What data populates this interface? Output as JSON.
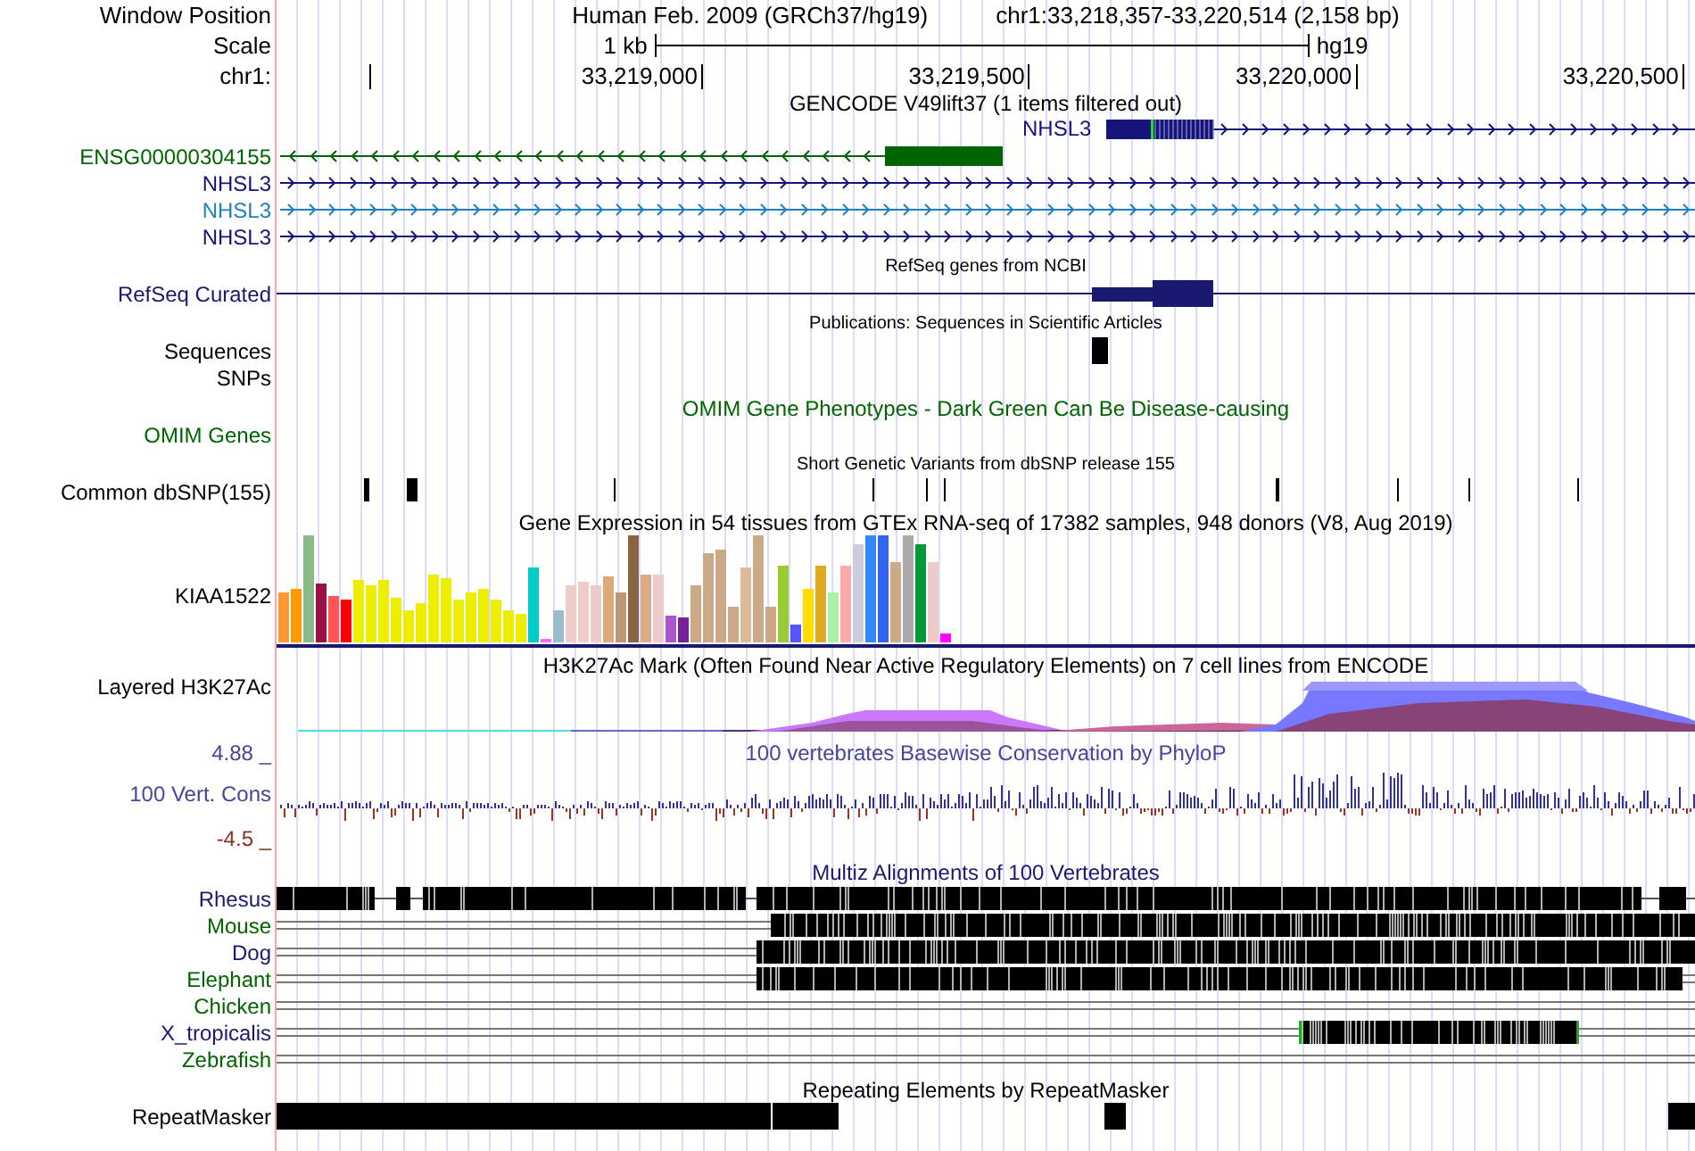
{
  "header": {
    "label": "Window Position",
    "assembly": "Human Feb. 2009 (GRCh37/hg19)",
    "position": "chr1:33,218,357-33,220,514 (2,158 bp)"
  },
  "scale": {
    "label": "Scale",
    "length": "1 kb",
    "assembly": "hg19"
  },
  "ruler": {
    "label": "chr1:",
    "ticks": [
      "33,219,000",
      "33,219,500",
      "33,220,000",
      "33,220,500"
    ]
  },
  "tracks": [
    {
      "kind": "gencode",
      "title": "GENCODE V49lift37 (1 items filtered out)",
      "genes": [
        {
          "name": "NHSL3",
          "name_inside": true,
          "reverse": false,
          "color": "#14147a"
        },
        {
          "name": "ENSG00000304155",
          "name_inside": false,
          "reverse": true,
          "color": "#006400"
        },
        {
          "name": "NHSL3",
          "name_inside": false,
          "reverse": false,
          "color": "#14147a"
        },
        {
          "name": "NHSL3",
          "name_inside": false,
          "reverse": false,
          "color": "#1f7fc0"
        },
        {
          "name": "NHSL3",
          "name_inside": false,
          "reverse": false,
          "color": "#14147a"
        }
      ]
    },
    {
      "kind": "refseq",
      "title": "RefSeq genes from NCBI",
      "label": "RefSeq Curated",
      "color": "#191970"
    },
    {
      "kind": "publications",
      "title": "Publications: Sequences in Scientific Articles",
      "label": "Sequences"
    },
    {
      "kind": "empty",
      "label": "SNPs"
    },
    {
      "kind": "omim",
      "title": "OMIM Gene Phenotypes - Dark Green Can Be Disease-causing",
      "label": "OMIM Genes",
      "color": "#006400"
    },
    {
      "kind": "dbsnp",
      "title": "Short Genetic Variants from dbSNP release 155",
      "label": "Common dbSNP(155)"
    },
    {
      "kind": "gtex",
      "title": "Gene Expression in 54 tissues from GTEx RNA-seq of 17382 samples, 948 donors (V8, Aug 2019)",
      "label": "KIAA1522"
    },
    {
      "kind": "h3k27ac",
      "title": "H3K27Ac Mark (Often Found Near Active Regulatory Elements) on 7 cell lines from ENCODE",
      "label": "Layered H3K27Ac"
    },
    {
      "kind": "phylop",
      "title": "100 vertebrates Basewise Conservation by PhyloP",
      "label": "100 Vert. Cons",
      "max_label": "4.88 _",
      "min_label": "-4.5 _",
      "color": "#45459a"
    },
    {
      "kind": "multiz",
      "title": "Multiz Alignments of 100 Vertebrates",
      "species": [
        {
          "name": "Rhesus",
          "color": "#191970"
        },
        {
          "name": "Mouse",
          "color": "#006400"
        },
        {
          "name": "Dog",
          "color": "#191970"
        },
        {
          "name": "Elephant",
          "color": "#006400"
        },
        {
          "name": "Chicken",
          "color": "#006400"
        },
        {
          "name": "X_tropicalis",
          "color": "#191970"
        },
        {
          "name": "Zebrafish",
          "color": "#006400"
        }
      ]
    },
    {
      "kind": "repeatmasker",
      "title": "Repeating Elements by RepeatMasker",
      "label": "RepeatMasker"
    }
  ]
}
